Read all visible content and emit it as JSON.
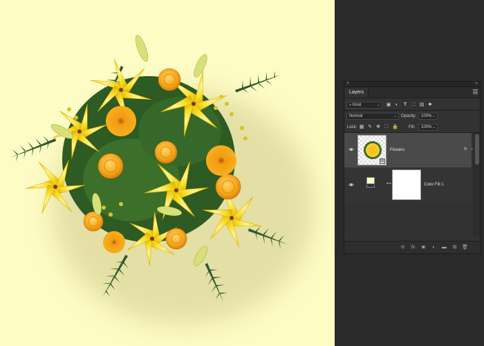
{
  "panel": {
    "title": "Layers",
    "collapse_glyph": "×",
    "expand_glyph": "»",
    "filter": {
      "label": "Kind",
      "icon": "search-icon"
    },
    "blend_mode": "Normal",
    "opacity": {
      "label": "Opacity:",
      "value": "100%"
    },
    "lock": {
      "label": "Lock:"
    },
    "fill": {
      "label": "Fill:",
      "value": "100%"
    },
    "layers": [
      {
        "name": "Flowers",
        "selected": true,
        "visible": true,
        "fx": "fx"
      },
      {
        "name": "Color Fill 1",
        "selected": false,
        "visible": true,
        "swatch": "#fdfcc4",
        "mask": "#ffffff"
      }
    ],
    "footer_icons": [
      "link-icon",
      "fx-icon",
      "mask-icon",
      "adjustment-icon",
      "folder-icon",
      "new-layer-icon",
      "trash-icon"
    ]
  },
  "colors": {
    "canvas_bg": "#fdfcc4",
    "panel_bg": "#323232",
    "selected_row": "#4a4a4a"
  }
}
